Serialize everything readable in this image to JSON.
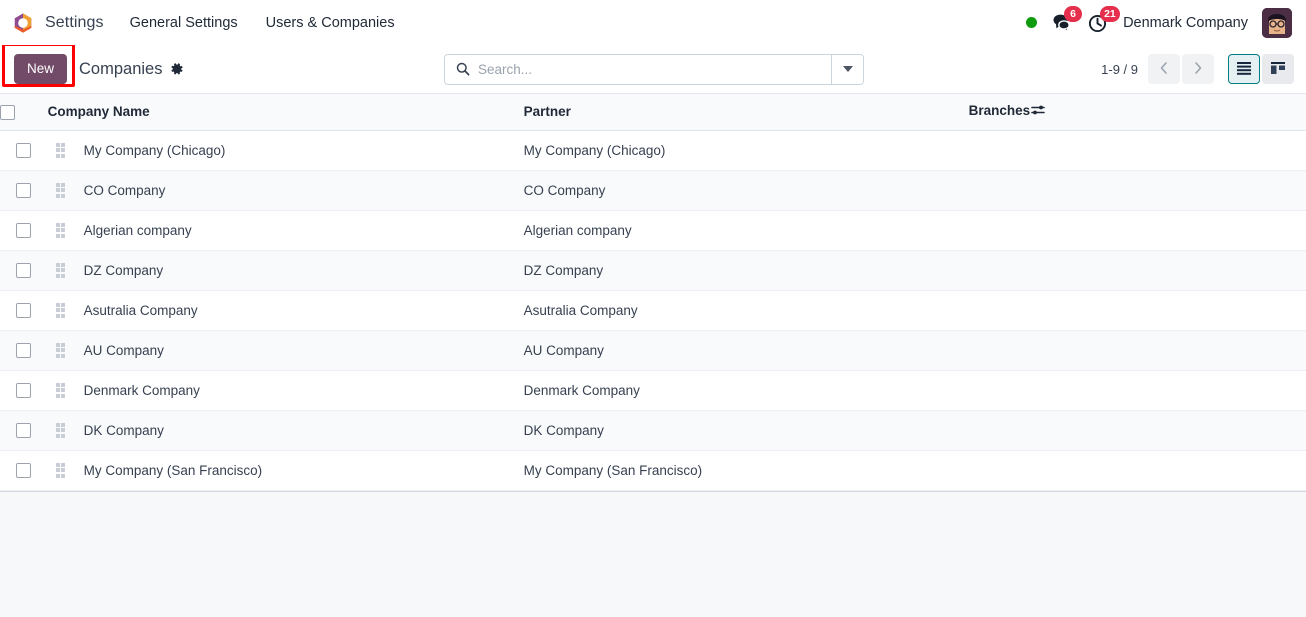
{
  "navbar": {
    "brand": "Settings",
    "logo_icon": "odoo-logo-icon",
    "menus": [
      {
        "label": "General Settings"
      },
      {
        "label": "Users & Companies"
      }
    ],
    "presence_icon": "presence-dot-icon",
    "presence_color": "#0E9C0E",
    "messages": {
      "icon": "messages-bubble-icon",
      "count": "6"
    },
    "activities": {
      "icon": "activity-clock-icon",
      "count": "21"
    },
    "badge_color": "#E62E4D",
    "user_name": "Denmark Company",
    "avatar_icon": "user-avatar-icon"
  },
  "control_panel": {
    "new_label": "New",
    "new_button_color": "#714B67",
    "annotation_color": "#FF0000",
    "breadcrumb": "Companies",
    "settings_icon": "gear-icon",
    "search": {
      "icon": "search-icon",
      "placeholder": "Search...",
      "value": "",
      "toggle_icon": "chevron-down-icon"
    },
    "pager": {
      "value": "1-9 / 9",
      "prev_icon": "chevron-left-icon",
      "next_icon": "chevron-right-icon"
    },
    "views": [
      {
        "name": "list",
        "icon": "list-view-icon",
        "active": true
      },
      {
        "name": "kanban",
        "icon": "kanban-view-icon",
        "active": false
      }
    ],
    "active_view_color": "#017E84"
  },
  "list": {
    "select_all_icon": "checkbox-icon",
    "optional_columns_icon": "sliders-icon",
    "columns": [
      "Company Name",
      "Partner",
      "Branches"
    ],
    "rows": [
      {
        "company_name": "My Company (Chicago)",
        "partner": "My Company (Chicago)",
        "branches": ""
      },
      {
        "company_name": "CO Company",
        "partner": "CO Company",
        "branches": ""
      },
      {
        "company_name": "Algerian company",
        "partner": "Algerian company",
        "branches": ""
      },
      {
        "company_name": "DZ Company",
        "partner": "DZ Company",
        "branches": ""
      },
      {
        "company_name": "Asutralia Company",
        "partner": "Asutralia Company",
        "branches": ""
      },
      {
        "company_name": "AU Company",
        "partner": "AU Company",
        "branches": ""
      },
      {
        "company_name": "Denmark Company",
        "partner": "Denmark Company",
        "branches": ""
      },
      {
        "company_name": "DK Company",
        "partner": "DK Company",
        "branches": ""
      },
      {
        "company_name": "My Company (San Francisco)",
        "partner": "My Company (San Francisco)",
        "branches": ""
      }
    ]
  }
}
